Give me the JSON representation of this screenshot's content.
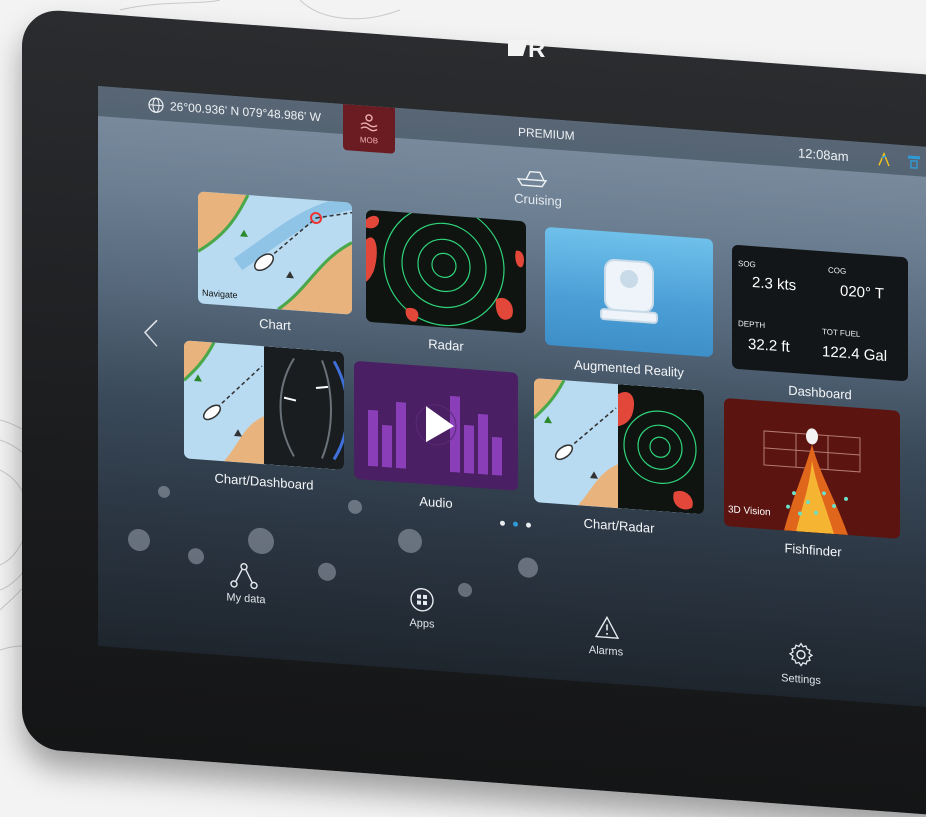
{
  "brand": "R",
  "status": {
    "coordinates": "26°00.936' N  079°48.986' W",
    "mob_label": "MOB",
    "mode": "PREMIUM",
    "time": "12:08am"
  },
  "profile": {
    "label": "Cruising"
  },
  "apps": [
    {
      "label": "Chart",
      "badge": "Navigate"
    },
    {
      "label": "Radar"
    },
    {
      "label": "Augmented Reality"
    },
    {
      "label": "Dashboard"
    },
    {
      "label": "Chart/Dashboard"
    },
    {
      "label": "Audio"
    },
    {
      "label": "Chart/Radar"
    },
    {
      "label": "Fishfinder",
      "badge": "3D Vision"
    }
  ],
  "dashboard": {
    "sog_label": "SOG",
    "sog_value": "2.3 kts",
    "cog_label": "COG",
    "cog_value": "020° T",
    "depth_label": "DEPTH",
    "depth_value": "32.2 ft",
    "fuel_label": "TOT FUEL",
    "fuel_value": "122.4 Gal"
  },
  "pager": {
    "pages": 3,
    "active": 2
  },
  "nav": {
    "my_data": "My data",
    "apps": "Apps",
    "alarms": "Alarms",
    "settings": "Settings"
  },
  "colors": {
    "accent": "#2f9bd8",
    "mob": "#6a1c22",
    "radar_green": "#2fd37a",
    "radar_red": "#e2473a"
  }
}
